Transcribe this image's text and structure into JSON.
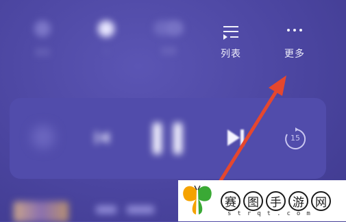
{
  "top_controls": {
    "blurred": [
      {
        "label": "音效"
      },
      {
        "label": "☆"
      },
      {
        "label": "倍速"
      }
    ],
    "list": {
      "label": "列表",
      "icon": "playlist-icon"
    },
    "more": {
      "label": "更多",
      "icon": "more-dots-icon"
    }
  },
  "player": {
    "forward_seconds": "15"
  },
  "annotation": {
    "arrow_color": "#e5472e"
  },
  "watermark": {
    "chars": [
      "赛",
      "图",
      "手",
      "游",
      "网"
    ],
    "url": "strqt.com"
  }
}
